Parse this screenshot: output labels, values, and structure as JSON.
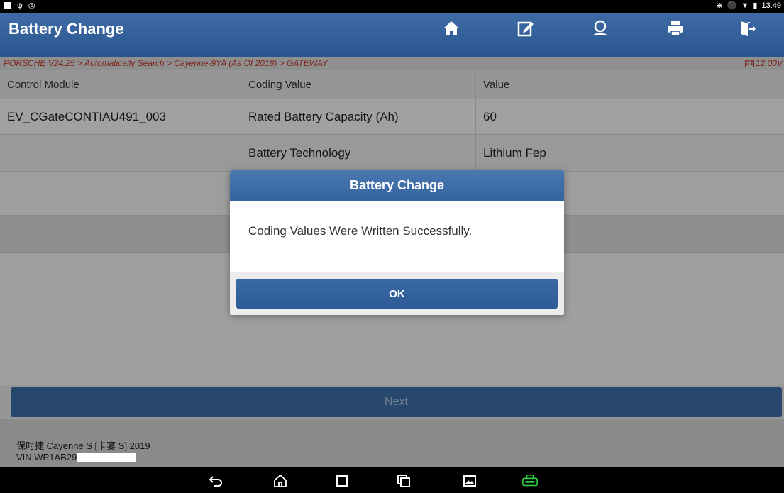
{
  "status_bar": {
    "time": "13:49",
    "left_icons": [
      "image-icon",
      "usb-icon",
      "accessibility-icon"
    ],
    "right_icons": [
      "bluetooth-icon",
      "do-not-disturb-icon",
      "wifi-icon",
      "battery-icon"
    ]
  },
  "header": {
    "title": "Battery Change",
    "toolbar": [
      "home-icon",
      "edit-icon",
      "user-icon",
      "print-icon",
      "exit-icon"
    ]
  },
  "breadcrumb": {
    "path": "PORSCHE V24.25 > Automatically Search > Cayenne-9YA (As Of 2018) > GATEWAY",
    "voltage": "12.00V"
  },
  "table": {
    "headers": [
      "Control Module",
      "Coding Value",
      "Value"
    ],
    "rows": [
      [
        "EV_CGateCONTIAU491_003",
        "Rated Battery Capacity (Ah)",
        "60"
      ],
      [
        "",
        "Battery Technology",
        "Lithium Fep"
      ]
    ]
  },
  "next_button": "Next",
  "footer": {
    "vehicle": "保时捷 Cayenne S [卡宴 S] 2019",
    "vin_prefix": "VIN WP1AB29"
  },
  "dialog": {
    "title": "Battery Change",
    "message": "Coding Values Were Written Successfully.",
    "ok": "OK"
  },
  "colors": {
    "accent": "#2d5b97",
    "breadcrumb_text": "#c0392b",
    "green_app_icon": "#2ecc40"
  }
}
